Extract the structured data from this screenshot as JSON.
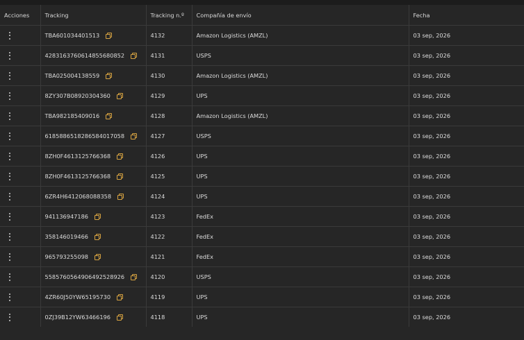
{
  "columns": [
    "Acciones",
    "Tracking",
    "Tracking n.º",
    "Compañía de envío",
    "Fecha"
  ],
  "rows": [
    {
      "tracking": "TBA601034401513",
      "number": "4132",
      "carrier": "Amazon Logistics (AMZL)",
      "date": "03 sep, 2026"
    },
    {
      "tracking": "4283163760614855680852",
      "number": "4131",
      "carrier": "USPS",
      "date": "03 sep, 2026"
    },
    {
      "tracking": "TBA025004138559",
      "number": "4130",
      "carrier": "Amazon Logistics (AMZL)",
      "date": "03 sep, 2026"
    },
    {
      "tracking": "8ZY307B08920304360",
      "number": "4129",
      "carrier": "UPS",
      "date": "03 sep, 2026"
    },
    {
      "tracking": "TBA982185409016",
      "number": "4128",
      "carrier": "Amazon Logistics (AMZL)",
      "date": "03 sep, 2026"
    },
    {
      "tracking": "6185886518286584017058",
      "number": "4127",
      "carrier": "USPS",
      "date": "03 sep, 2026"
    },
    {
      "tracking": "8ZH0F4613125766368",
      "number": "4126",
      "carrier": "UPS",
      "date": "03 sep, 2026"
    },
    {
      "tracking": "8ZH0F4613125766368",
      "number": "4125",
      "carrier": "UPS",
      "date": "03 sep, 2026"
    },
    {
      "tracking": "6ZR4H6412068088358",
      "number": "4124",
      "carrier": "UPS",
      "date": "03 sep, 2026"
    },
    {
      "tracking": "941136947186",
      "number": "4123",
      "carrier": "FedEx",
      "date": "03 sep, 2026"
    },
    {
      "tracking": "358146019466",
      "number": "4122",
      "carrier": "FedEx",
      "date": "03 sep, 2026"
    },
    {
      "tracking": "965793255098",
      "number": "4121",
      "carrier": "FedEx",
      "date": "03 sep, 2026"
    },
    {
      "tracking": "5585760564906492528926",
      "number": "4120",
      "carrier": "USPS",
      "date": "03 sep, 2026"
    },
    {
      "tracking": "4ZR60J50YW65195730",
      "number": "4119",
      "carrier": "UPS",
      "date": "03 sep, 2026"
    },
    {
      "tracking": "0ZJ39B12YW63466196",
      "number": "4118",
      "carrier": "UPS",
      "date": "03 sep, 2026"
    }
  ],
  "icons": {
    "row_menu": "kebab-menu-icon",
    "copy": "copy-icon"
  },
  "colors": {
    "background": "#262626",
    "accent": "#d9a441",
    "border": "#3a3a3a"
  }
}
